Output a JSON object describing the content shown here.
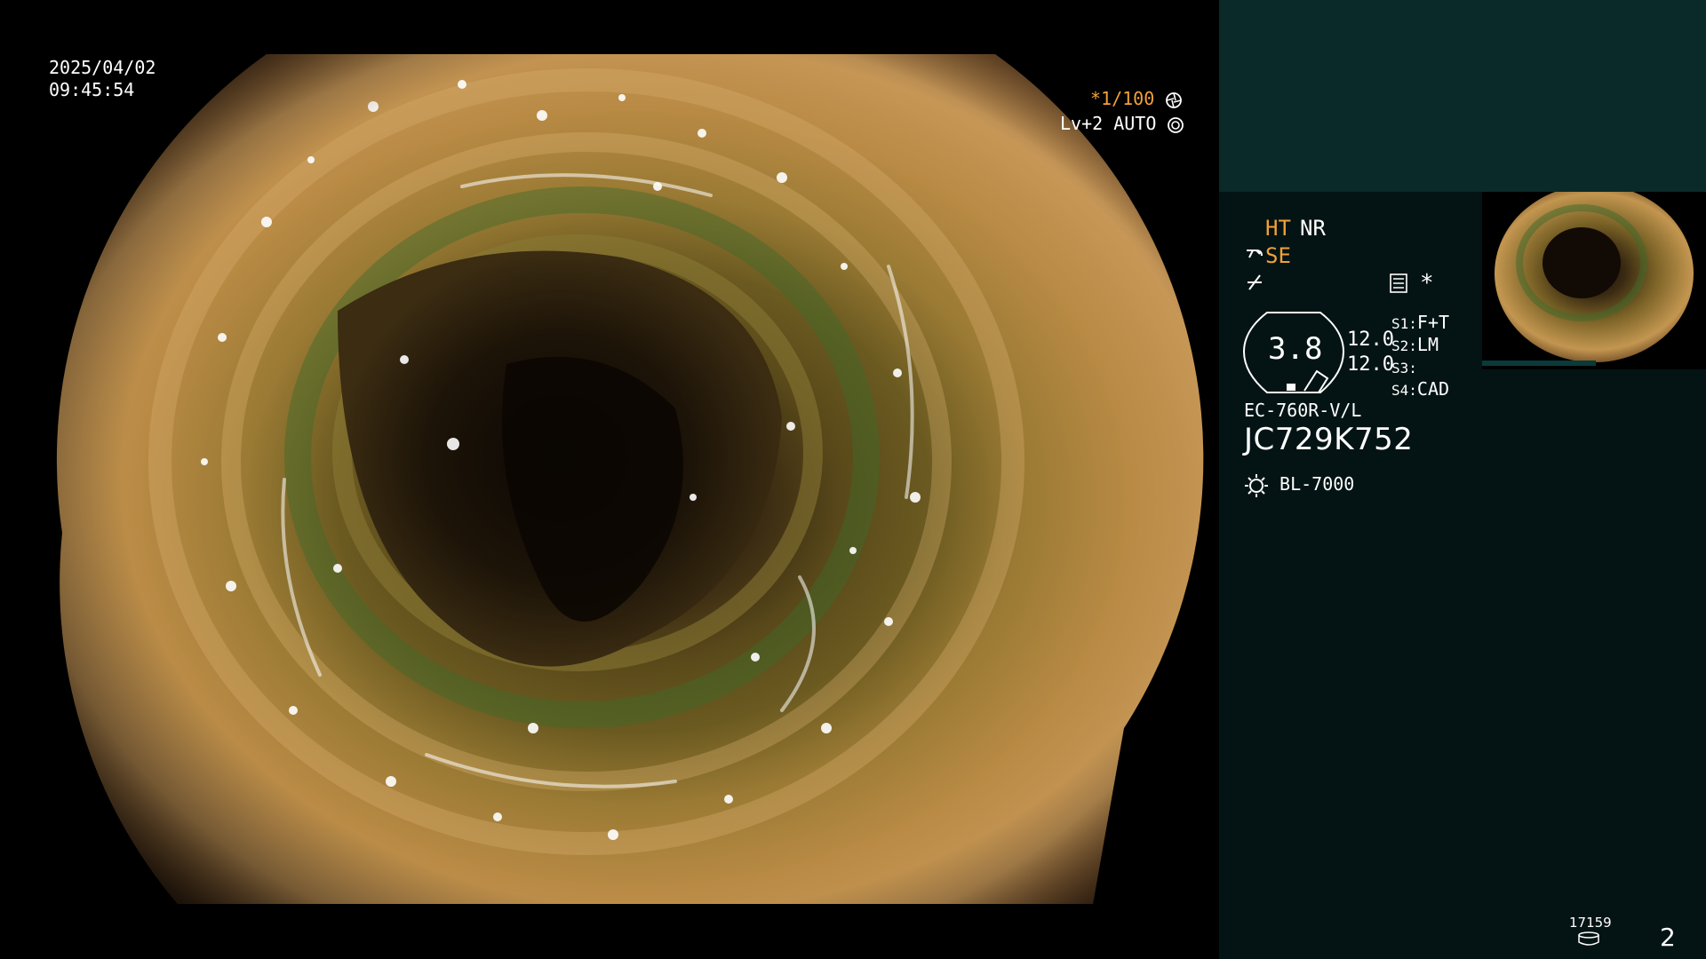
{
  "overlay": {
    "date": "2025/04/02",
    "time": "09:45:54",
    "shutter": "*1/100",
    "level": "Lv+2",
    "iris": "AUTO"
  },
  "panel": {
    "mode_ht": "HT",
    "mode_nr": "NR",
    "mode_se": "SE",
    "magnification": "3.8",
    "gain_1": "12.0",
    "gain_2": "12.0",
    "switches": [
      {
        "key": "S1:",
        "value": "F+T"
      },
      {
        "key": "S2:",
        "value": "LM"
      },
      {
        "key": "S3:",
        "value": ""
      },
      {
        "key": "S4:",
        "value": "CAD"
      }
    ],
    "scope_model": "EC-760R-V/L",
    "serial": "JC729K752",
    "light_source": "BL-7000",
    "counter": "17159",
    "page": "2",
    "star": "*"
  },
  "colors": {
    "accent_orange": "#f2a03a",
    "panel_bg": "#041414",
    "panel_top": "#0a2a2a"
  },
  "icons": {
    "shutter": "aperture-icon",
    "iris": "iris-icon",
    "scope_bend": "scope-icon",
    "slash": "slash-icon",
    "menu": "menu-icon",
    "light": "sun-icon",
    "storage": "disk-icon"
  }
}
